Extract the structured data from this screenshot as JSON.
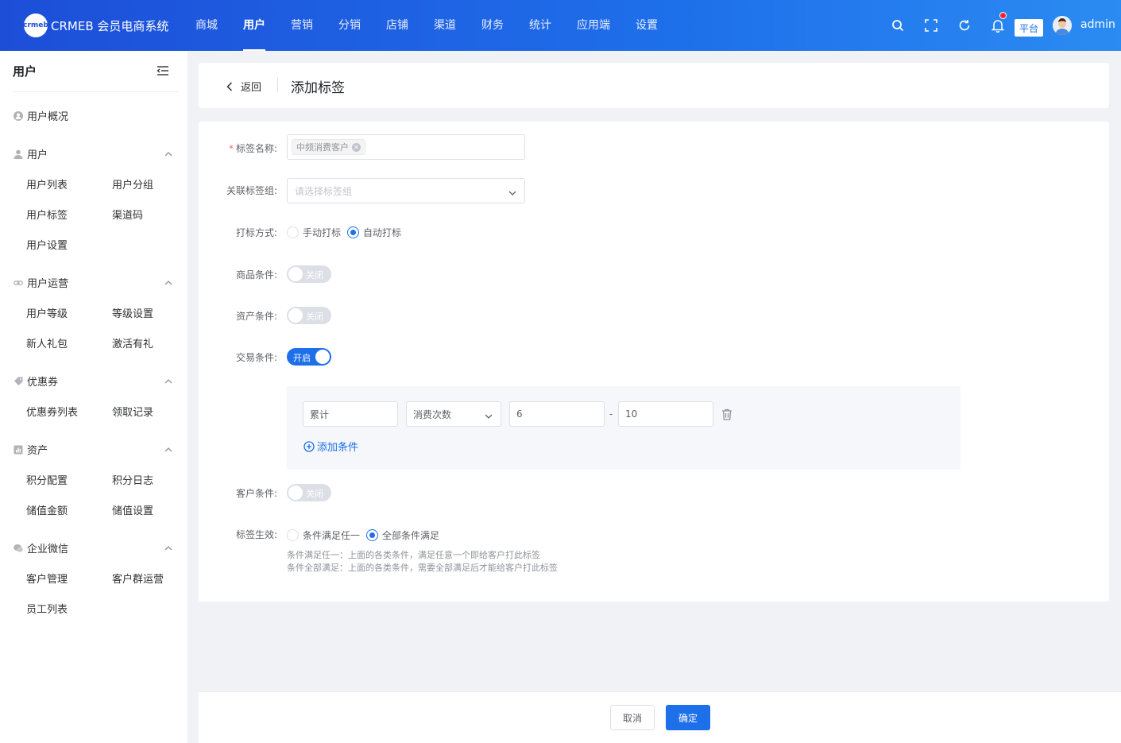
{
  "topbar": {
    "logo_mark": "crmeb",
    "app_name": "CRMEB 会员电商系统",
    "nav": [
      "商城",
      "用户",
      "营销",
      "分销",
      "店铺",
      "渠道",
      "财务",
      "统计",
      "应用端",
      "设置"
    ],
    "active_nav": "用户",
    "platform_label": "平台",
    "username": "admin"
  },
  "sidebar": {
    "title": "用户",
    "overview": "用户概况",
    "groups": [
      {
        "title": "用户",
        "items": [
          "用户列表",
          "用户分组",
          "用户标签",
          "渠道码",
          "用户设置"
        ]
      },
      {
        "title": "用户运营",
        "items": [
          "用户等级",
          "等级设置",
          "新人礼包",
          "激活有礼"
        ]
      },
      {
        "title": "优惠券",
        "items": [
          "优惠券列表",
          "领取记录"
        ]
      },
      {
        "title": "资产",
        "items": [
          "积分配置",
          "积分日志",
          "储值金额",
          "储值设置"
        ]
      },
      {
        "title": "企业微信",
        "items": [
          "客户管理",
          "客户群运营",
          "员工列表"
        ]
      }
    ]
  },
  "header": {
    "back_label": "返回",
    "title": "添加标签"
  },
  "form": {
    "tag_name_label": "标签名称:",
    "tag_name_value": "中频消费客户",
    "related_group_label": "关联标签组:",
    "related_group_placeholder": "请选择标签组",
    "mark_method_label": "打标方式:",
    "mark_method_options": [
      "手动打标",
      "自动打标"
    ],
    "mark_method_selected": "自动打标",
    "goods_condition_label": "商品条件:",
    "goods_condition_state": "关闭",
    "asset_condition_label": "资产条件:",
    "asset_condition_state": "关闭",
    "trade_condition_label": "交易条件:",
    "trade_condition_state": "开启",
    "trade_rule": {
      "scope": "累计",
      "metric": "消费次数",
      "min": "6",
      "max": "10",
      "separator": "-"
    },
    "add_condition_label": "添加条件",
    "customer_condition_label": "客户条件:",
    "customer_condition_state": "关闭",
    "effect_label": "标签生效:",
    "effect_options": [
      "条件满足任一",
      "全部条件满足"
    ],
    "effect_selected": "全部条件满足",
    "hint_any": "条件满足任一：上面的各类条件，满足任意一个即给客户打此标签",
    "hint_all": "条件全部满足：上面的各类条件，需要全部满足后才能给客户打此标签"
  },
  "footer": {
    "cancel_label": "取消",
    "confirm_label": "确定"
  },
  "colors": {
    "primary": "#1e6fea",
    "danger": "#f56c6c",
    "topbar_start": "#1d4ed8",
    "topbar_end": "#2b8bf2"
  },
  "icons": [
    "search-icon",
    "fullscreen-icon",
    "refresh-icon",
    "bell-icon",
    "collapse-menu-icon",
    "chevron-up-icon",
    "chevron-down-icon",
    "chevron-left-icon",
    "trash-icon",
    "plus-circle-icon"
  ]
}
